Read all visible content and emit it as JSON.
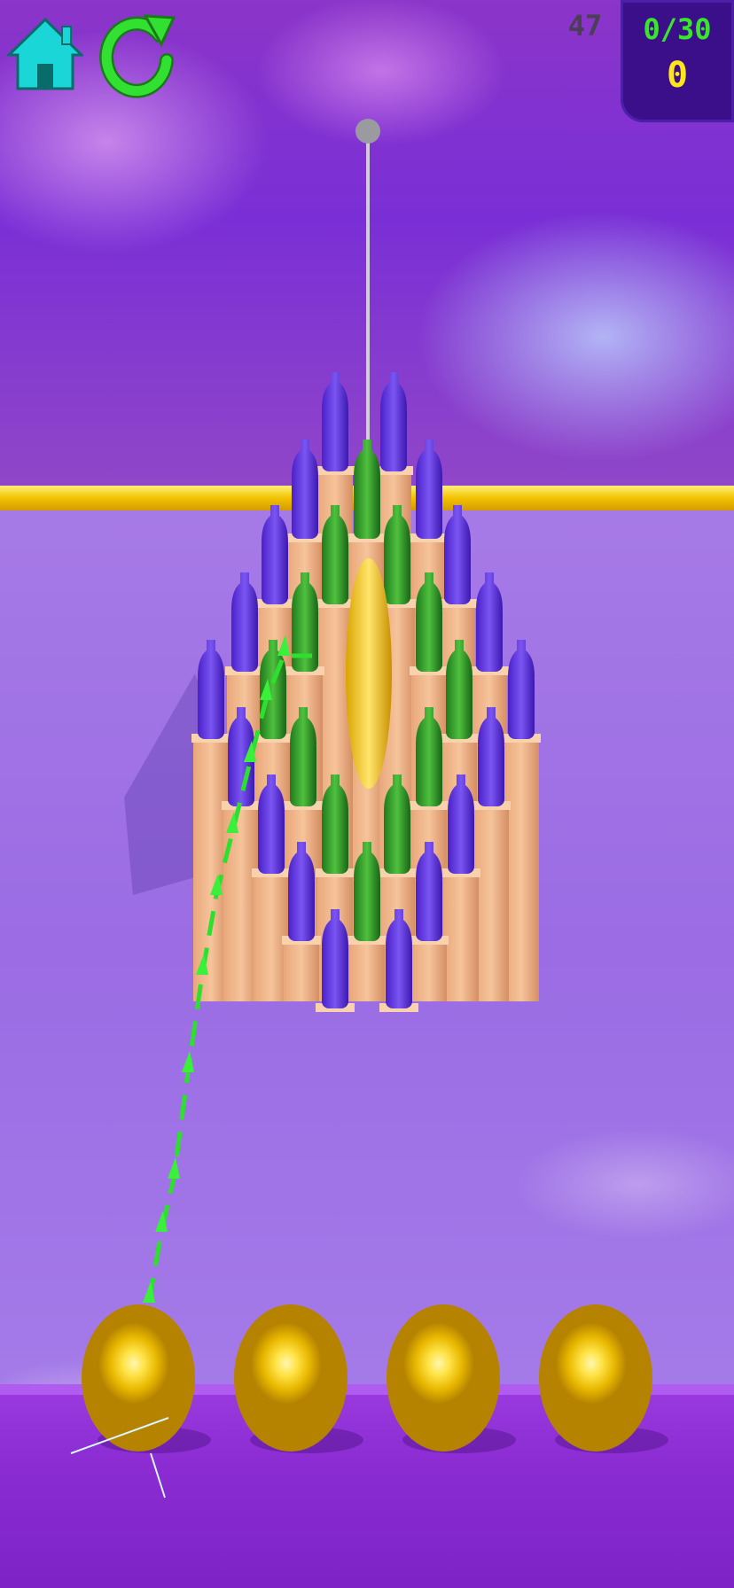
{
  "hud": {
    "fps": "47",
    "bottles_progress": "0/30",
    "score": "0"
  },
  "icons": {
    "home": "home-icon",
    "restart": "restart-icon"
  },
  "colors": {
    "hud_panel": "#3b0f8a",
    "progress_text": "#39e62b",
    "score_text": "#ffe61a",
    "bottle_blue": "#5a2ee0",
    "bottle_green": "#2f9a2a",
    "balls": "#f0c400"
  },
  "balls_remaining": 4
}
